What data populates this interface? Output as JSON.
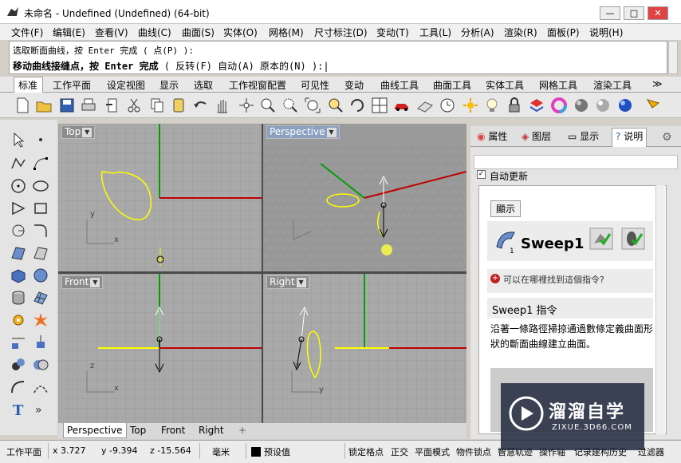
{
  "window": {
    "title": "未命名 - Undefined (Undefined) (64-bit)",
    "min": "—",
    "max": "□",
    "close": "✕"
  },
  "menu": [
    "文件(F)",
    "编辑(E)",
    "查看(V)",
    "曲线(C)",
    "曲面(S)",
    "实体(O)",
    "网格(M)",
    "尺寸标注(D)",
    "变动(T)",
    "工具(L)",
    "分析(A)",
    "渲染(R)",
    "面板(P)",
    "说明(H)"
  ],
  "command": {
    "history": "选取断面曲线，按 Enter 完成 ( 点(P) ):",
    "prompt_main": "移动曲线接缝点，按 Enter 完成",
    "prompt_options": " ( 反转(F)  自动(A)  原本的(N) ):|"
  },
  "toolbar_tabs": [
    "标准",
    "工作平面",
    "设定视图",
    "显示",
    "选取",
    "工作视窗配置",
    "可见性",
    "变动",
    "曲线工具",
    "曲面工具",
    "实体工具",
    "网格工具",
    "渲染工具",
    "≫"
  ],
  "toolbar_icons": [
    "new-icon",
    "open-icon",
    "save-icon",
    "print-icon",
    "import-icon",
    "cut-icon",
    "copy-icon",
    "paste-icon",
    "undo-icon",
    "pan-hand-icon",
    "rotate-view-icon",
    "zoom-icon",
    "zoom-window-icon",
    "zoom-extents-icon",
    "zoom-selected-icon",
    "rotate-icon",
    "four-view-icon",
    "car-icon",
    "plane-icon",
    "clock-icon",
    "sun-icon",
    "light-icon",
    "lock-icon",
    "layer-icon",
    "color-wheel-icon",
    "sphere-grey-icon",
    "sphere-white-icon",
    "sphere-blue-icon",
    "more-icon"
  ],
  "viewports": {
    "top": {
      "label": "Top"
    },
    "perspective": {
      "label": "Perspective"
    },
    "front": {
      "label": "Front"
    },
    "right": {
      "label": "Right"
    }
  },
  "axis_labels": {
    "x": "x",
    "y": "y",
    "z": "z"
  },
  "viewport_tabs": [
    "Perspective",
    "Top",
    "Front",
    "Right",
    "+"
  ],
  "panel": {
    "tabs": [
      "属性",
      "图层",
      "显示",
      "说明"
    ],
    "auto_update": "自动更新",
    "show_button": "顯示",
    "command_name": "Sweep1",
    "where_link": "可以在哪裡找到這個指令?",
    "section_title": "Sweep1 指令",
    "description": "沿著一條路徑掃掠通過數條定義曲面形狀的斷面曲線建立曲面。"
  },
  "status": {
    "cplane": "工作平面",
    "x": "x 3.727",
    "y": "y -9.394",
    "z": "z -15.564",
    "unit": "毫米",
    "layer": "预设值",
    "snap": "锁定格点",
    "ortho": "正交",
    "planar": "平面模式",
    "osnap": "物件锁点",
    "smarttrack": "智慧轨迹",
    "gumball": "操作轴",
    "history": "记录建构历史",
    "filter": "过滤器"
  },
  "watermark": {
    "title": "溜溜自学",
    "url": "ZIXUE.3D66.COM"
  },
  "colors": {
    "accent": "#316ac5",
    "grid_bg": "#a9a9a9",
    "curve": "#ffff00",
    "x_axis": "#c00000",
    "y_axis": "#00a000"
  }
}
